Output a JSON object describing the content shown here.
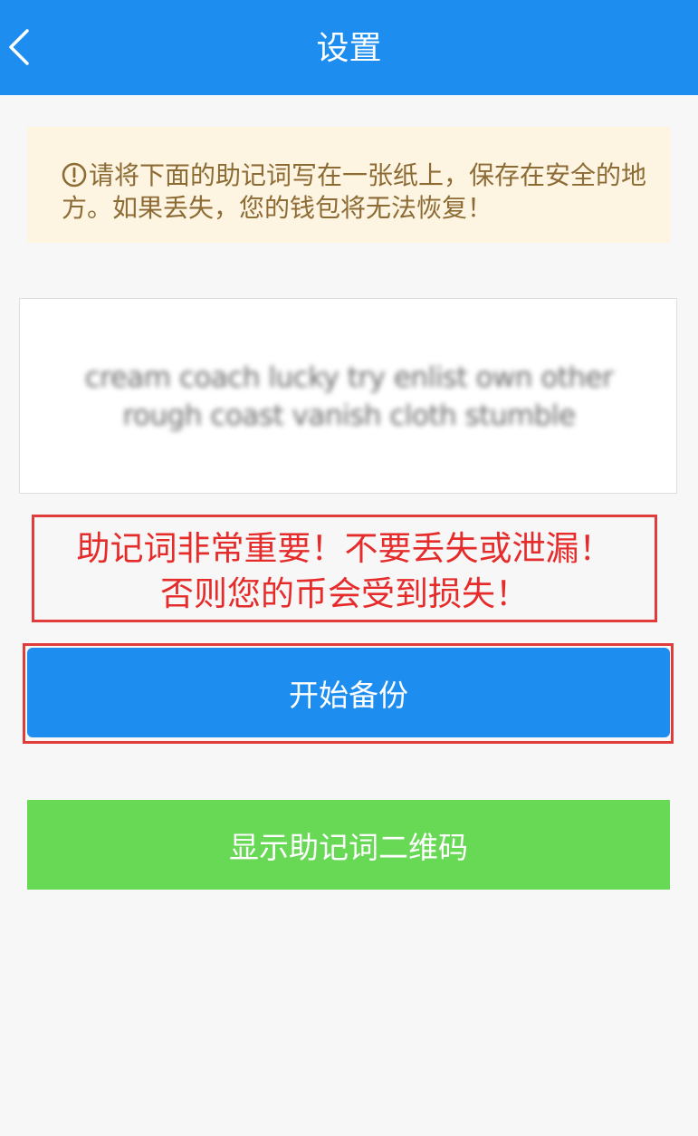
{
  "header": {
    "title": "设置",
    "back_icon": "chevron-left-icon"
  },
  "warning": {
    "icon": "exclamation-circle-icon",
    "text": "请将下面的助记词写在一张纸上，保存在安全的地方。如果丢失，您的钱包将无法恢复！"
  },
  "mnemonic": {
    "line1": "cream coach lucky try enlist own other",
    "line2": "rough coast vanish cloth stumble"
  },
  "alert": {
    "line1": "助记词非常重要！不要丢失或泄漏！",
    "line2": "否则您的币会受到损失！"
  },
  "buttons": {
    "start_backup": "开始备份",
    "show_qr": "显示助记词二维码"
  },
  "colors": {
    "primary": "#1d8ef0",
    "success": "#67d955",
    "warning_bg": "#fdf5e1",
    "warning_text": "#8d6b35",
    "alert": "#e62b2b"
  }
}
